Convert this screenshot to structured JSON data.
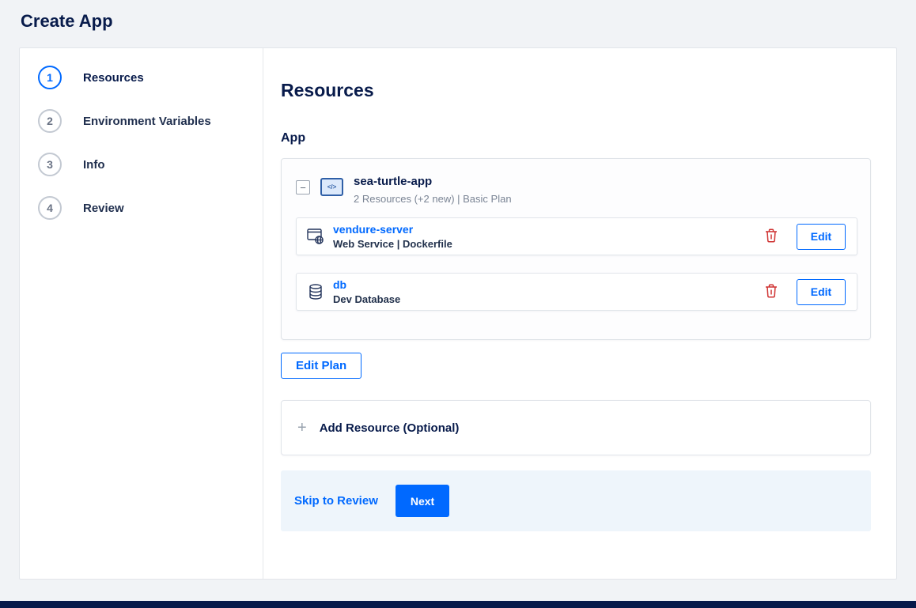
{
  "page": {
    "title": "Create App"
  },
  "colors": {
    "accent": "#0069ff",
    "navy": "#081b4b",
    "danger": "#cf3130"
  },
  "stepper": {
    "steps": [
      {
        "number": "1",
        "label": "Resources"
      },
      {
        "number": "2",
        "label": "Environment Variables"
      },
      {
        "number": "3",
        "label": "Info"
      },
      {
        "number": "4",
        "label": "Review"
      }
    ]
  },
  "content": {
    "heading": "Resources",
    "section_label": "App",
    "app_group": {
      "collapse_icon": "−",
      "code_icon": "</>",
      "name": "sea-turtle-app",
      "summary": "2 Resources (+2 new) | Basic Plan"
    },
    "resources": [
      {
        "name": "vendure-server",
        "subtitle": "Web Service | Dockerfile",
        "edit_label": "Edit"
      },
      {
        "name": "db",
        "subtitle": "Dev Database",
        "edit_label": "Edit"
      }
    ],
    "edit_plan_label": "Edit Plan",
    "add_resource": {
      "plus_icon": "+",
      "label": "Add Resource (Optional)"
    },
    "footer": {
      "skip_label": "Skip to Review",
      "next_label": "Next"
    }
  }
}
